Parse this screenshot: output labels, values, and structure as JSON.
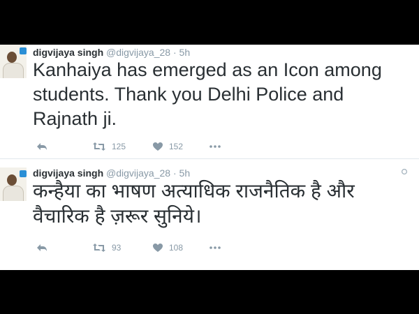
{
  "tweets": [
    {
      "name": "digvijaya singh",
      "handle": "@digvijaya_28",
      "separator": "·",
      "time": "5h",
      "text": "Kanhaiya has emerged as an Icon among students. Thank you Delhi Police and Rajnath ji.",
      "retweets": "125",
      "likes": "152"
    },
    {
      "name": "digvijaya singh",
      "handle": "@digvijaya_28",
      "separator": "·",
      "time": "5h",
      "text": "कन्हैया का भाषण अत्याधिक राजनैतिक है और वैचारिक है ज़रूर सुनिये।",
      "retweets": "93",
      "likes": "108"
    }
  ],
  "icons": {
    "reply": "reply-icon",
    "retweet": "retweet-icon",
    "like": "heart-icon",
    "more": "more-icon",
    "caret": "chevron-down-icon"
  },
  "colors": {
    "name": "#292f33",
    "meta": "#8899a6",
    "accent": "#2a8fd6"
  }
}
